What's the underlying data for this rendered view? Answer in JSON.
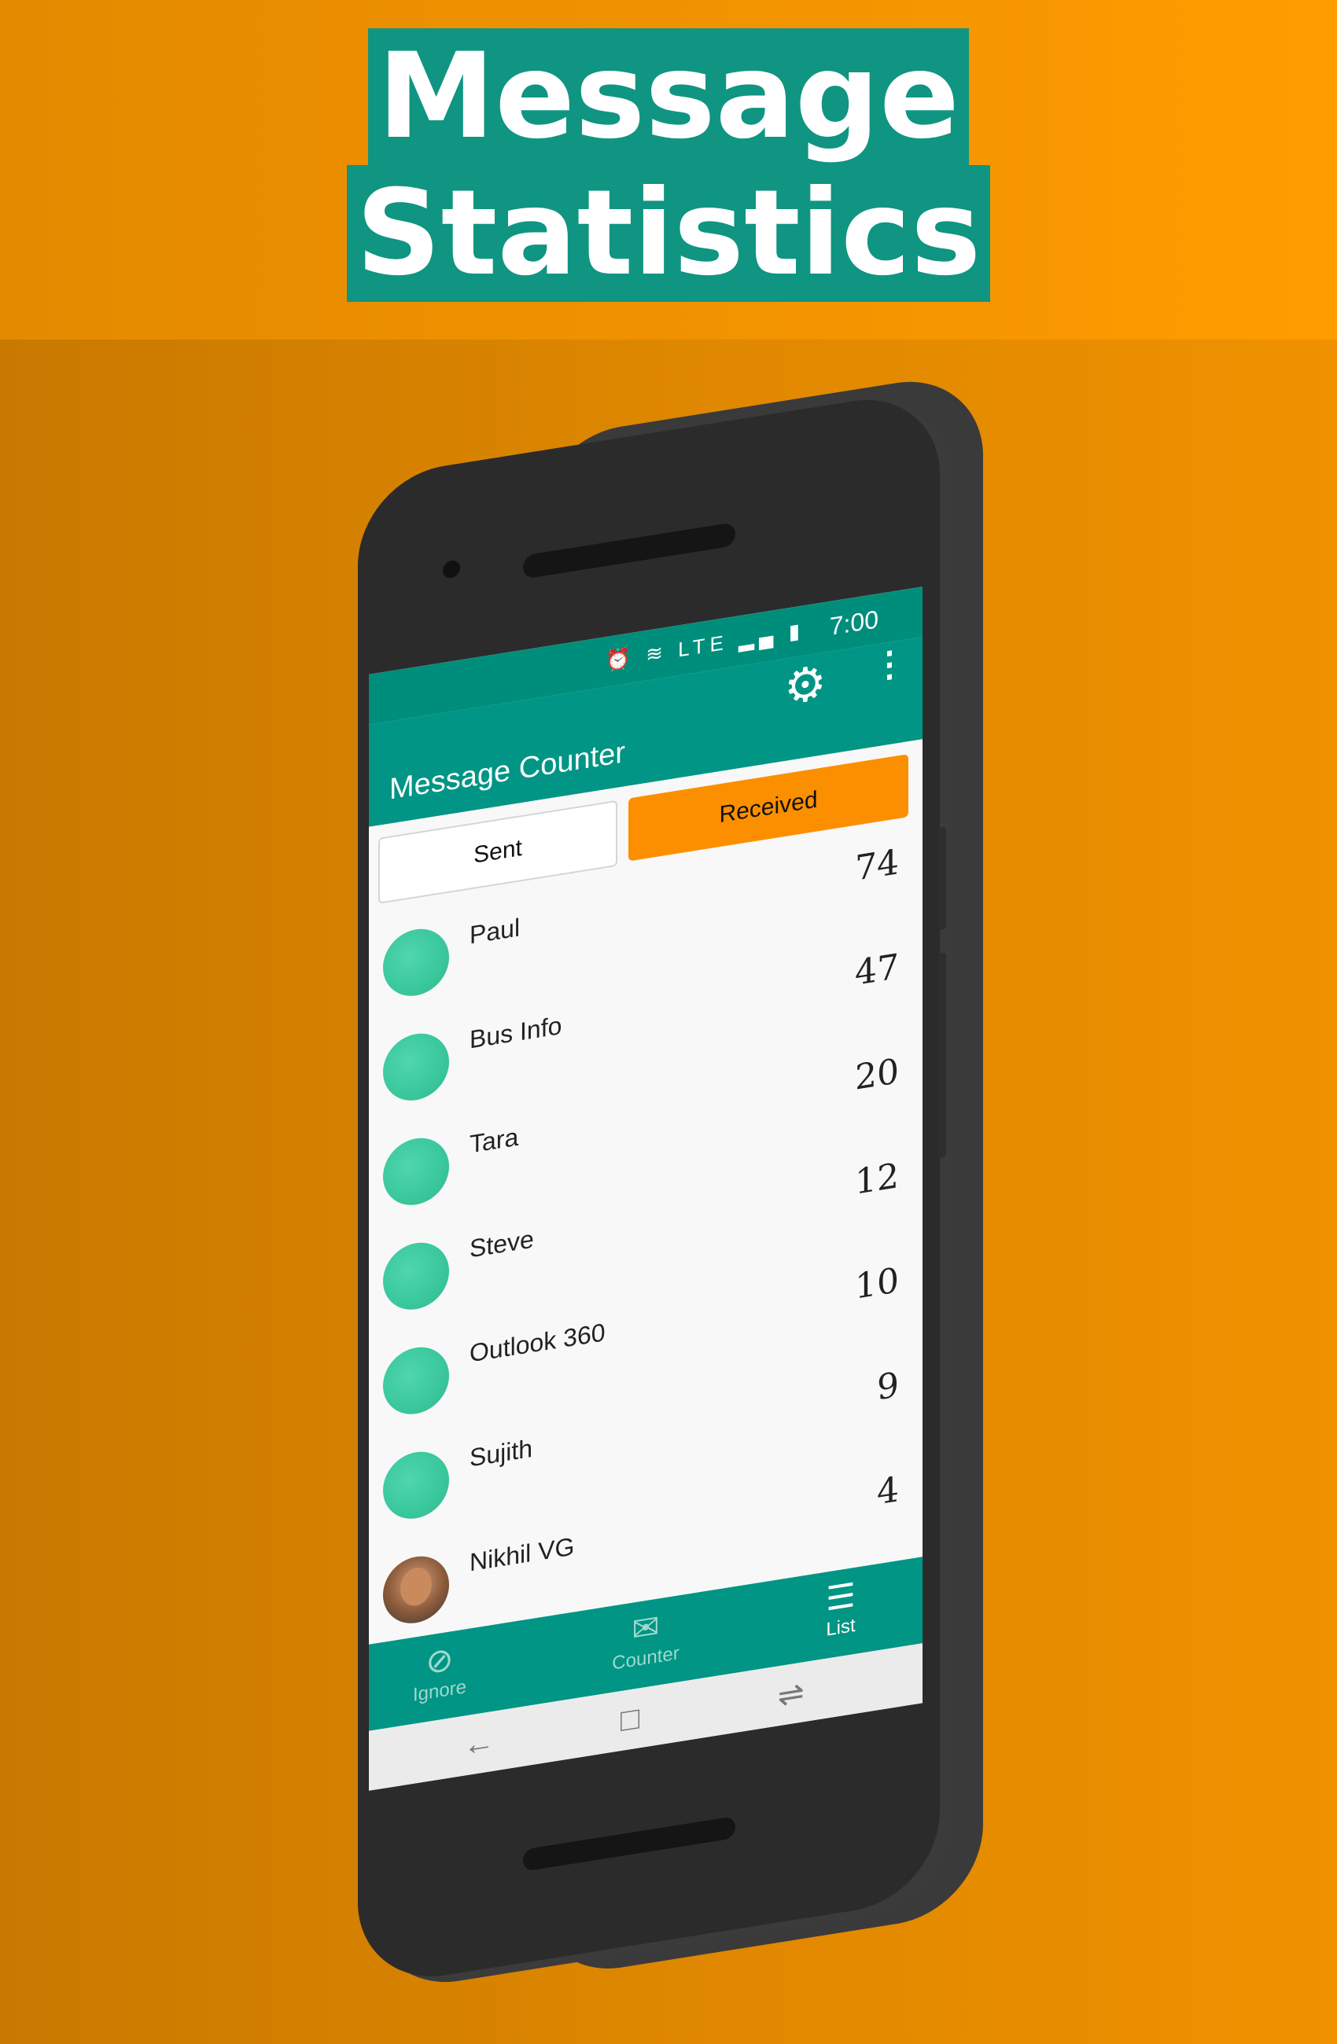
{
  "headline": {
    "line1": "Message",
    "line2": "Statistics"
  },
  "status_bar": {
    "icons": "⏰ ≋ LTE ▂▄ ▮",
    "time": "7:00"
  },
  "app": {
    "title": "Message Counter",
    "settings_icon": "gear-icon",
    "menu_icon": "more-vertical-icon"
  },
  "tabs": {
    "sent": "Sent",
    "received": "Received",
    "active": "Received"
  },
  "contacts": [
    {
      "name": "Paul",
      "count": "74"
    },
    {
      "name": "Bus Info",
      "count": "47"
    },
    {
      "name": "Tara",
      "count": "20"
    },
    {
      "name": "Steve",
      "count": "12"
    },
    {
      "name": "Outlook 360",
      "count": "10"
    },
    {
      "name": "Sujith",
      "count": "9"
    },
    {
      "name": "Nikhil VG",
      "count": "4"
    }
  ],
  "bottom_nav": {
    "ignore": "Ignore",
    "counter": "Counter",
    "list": "List",
    "active": "List"
  },
  "colors": {
    "teal": "#009584",
    "orange": "#fc8f00",
    "headline_bg": "#0f9582",
    "background": "#e08800"
  }
}
